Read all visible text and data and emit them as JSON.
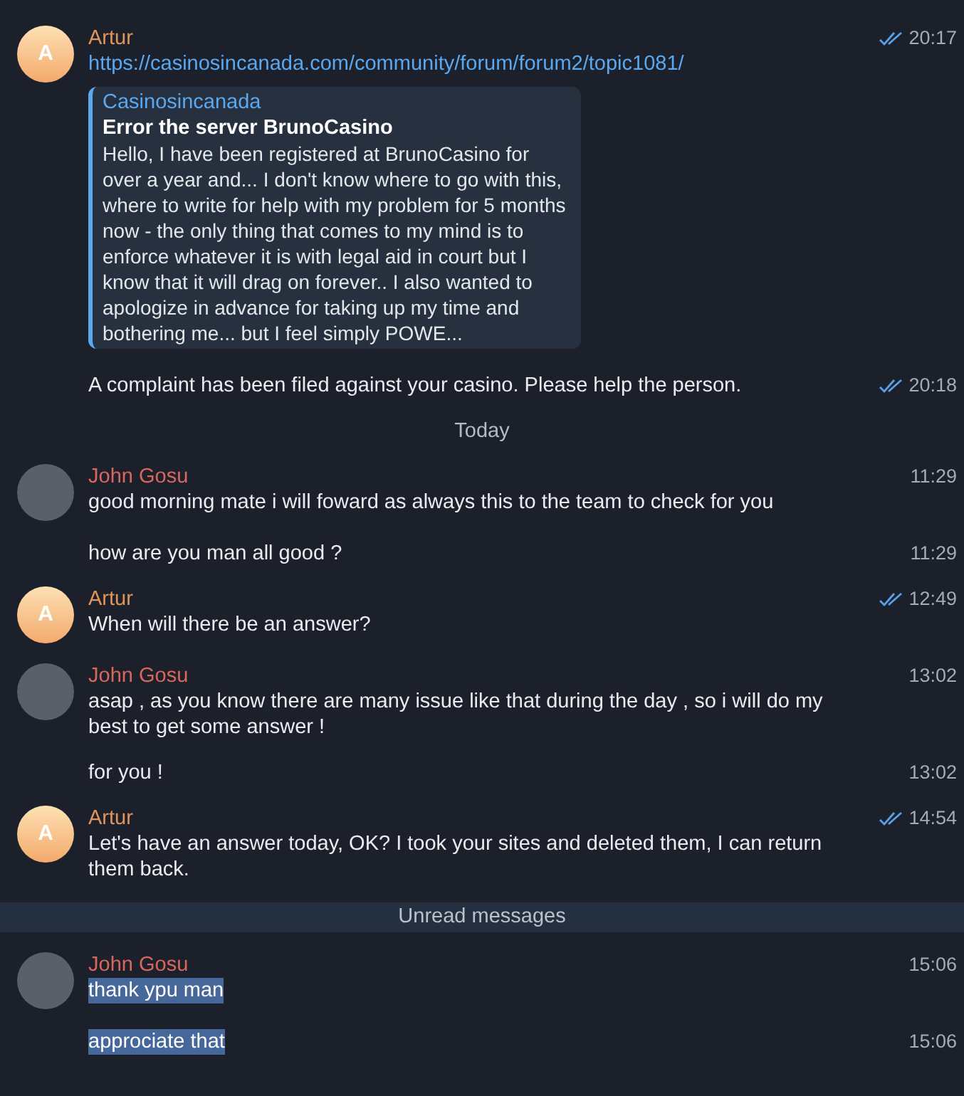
{
  "messages": [
    {
      "kind": "message",
      "sender": "Artur",
      "color": "#e0965a",
      "avatar": {
        "kind": "letter",
        "text": "A"
      },
      "link": "https://casinosincanada.com/community/forum/forum2/topic1081/",
      "quote": {
        "source": "Casinosincanada",
        "title": "Error the server BrunoCasino",
        "text": "Hello, I have been registered at BrunoCasino for over a year and... I don't know where to go with this, where to write for help with my problem for 5 months now - the only thing that comes to my mind is to enforce whatever it is with legal aid in court but I know that it will drag on forever.. I also wanted to apologize in advance for taking up my time and bothering me... but I feel simply POWE..."
      },
      "time": "20:17",
      "read": true
    },
    {
      "kind": "message",
      "text": "A complaint has been filed against your casino. Please help the person.",
      "time": "20:18",
      "read": true,
      "selected": false
    },
    {
      "kind": "date",
      "text": "Today"
    },
    {
      "kind": "message",
      "sender": "John Gosu",
      "color": "#d9675d",
      "avatar": {
        "kind": "photo"
      },
      "text": "good morning mate i will foward as always this to the team to check for you",
      "time": "11:29",
      "selected": false
    },
    {
      "kind": "message",
      "text": "how are you man all good ?",
      "time": "11:29",
      "selected": false
    },
    {
      "kind": "message",
      "sender": "Artur",
      "color": "#e0965a",
      "avatar": {
        "kind": "letter",
        "text": "A"
      },
      "text": "When will there be an answer?",
      "time": "12:49",
      "read": true,
      "selected": false
    },
    {
      "kind": "message",
      "sender": "John Gosu",
      "color": "#d9675d",
      "avatar": {
        "kind": "photo"
      },
      "text": "asap , as you know  there are many issue like that during the day , so i will do my best  to get some answer !",
      "time": "13:02",
      "selected": false
    },
    {
      "kind": "message",
      "text": "for  you !",
      "time": "13:02",
      "selected": false
    },
    {
      "kind": "message",
      "sender": "Artur",
      "color": "#e0965a",
      "avatar": {
        "kind": "letter",
        "text": "A"
      },
      "text": "Let's have an answer today, OK? I took your sites and deleted them, I can return them back.",
      "time": "14:54",
      "read": true,
      "selected": false
    },
    {
      "kind": "unread",
      "text": "Unread messages"
    },
    {
      "kind": "message",
      "sender": "John Gosu",
      "color": "#d9675d",
      "avatar": {
        "kind": "photo"
      },
      "text": "thank ypu man",
      "time": "15:06",
      "selected": true
    },
    {
      "kind": "message",
      "text": "approciate that",
      "time": "15:06",
      "selected": true
    }
  ]
}
